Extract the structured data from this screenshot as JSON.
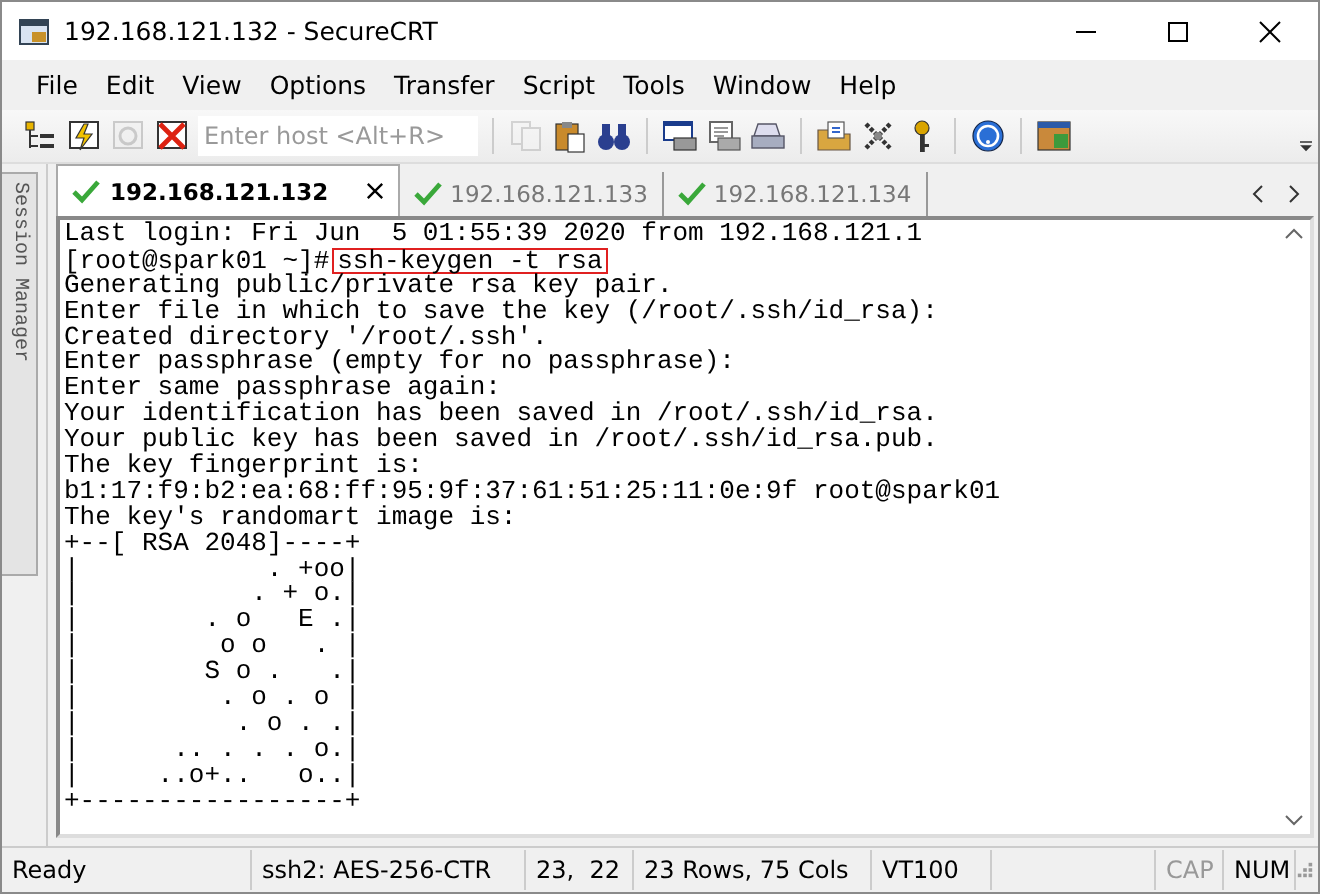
{
  "window": {
    "title": "192.168.121.132 - SecureCRT"
  },
  "menu": [
    "File",
    "Edit",
    "View",
    "Options",
    "Transfer",
    "Script",
    "Tools",
    "Window",
    "Help"
  ],
  "toolbar": {
    "buttons": [
      {
        "kind": "tree",
        "disabled": false
      },
      {
        "kind": "connect",
        "disabled": false
      },
      {
        "kind": "reconnect",
        "disabled": true
      },
      {
        "kind": "disconnect",
        "disabled": false
      },
      {
        "kind": "host",
        "placeholder": "Enter host <Alt+R>"
      },
      {
        "kind": "separator"
      },
      {
        "kind": "copy",
        "disabled": true
      },
      {
        "kind": "paste",
        "disabled": false
      },
      {
        "kind": "find",
        "disabled": false
      },
      {
        "kind": "separator"
      },
      {
        "kind": "print-screen",
        "disabled": false
      },
      {
        "kind": "print-selection",
        "disabled": false
      },
      {
        "kind": "print",
        "disabled": false
      },
      {
        "kind": "separator"
      },
      {
        "kind": "options",
        "disabled": false
      },
      {
        "kind": "tools",
        "disabled": false
      },
      {
        "kind": "key",
        "disabled": false
      },
      {
        "kind": "separator"
      },
      {
        "kind": "help",
        "disabled": false
      },
      {
        "kind": "separator"
      },
      {
        "kind": "sftp",
        "disabled": false
      }
    ]
  },
  "session_manager": {
    "label": "Session Manager"
  },
  "tabs": [
    {
      "label": "192.168.121.132",
      "selected": true
    },
    {
      "label": "192.168.121.133",
      "selected": false
    },
    {
      "label": "192.168.121.134",
      "selected": false
    }
  ],
  "terminal": {
    "lines": [
      {
        "text": "Last login: Fri Jun  5 01:55:39 2020 from 192.168.121.1"
      },
      {
        "prompt": "[root@spark01 ~]#",
        "command": "ssh-keygen -t rsa",
        "highlighted": true
      },
      {
        "text": "Generating public/private rsa key pair."
      },
      {
        "text": "Enter file in which to save the key (/root/.ssh/id_rsa):"
      },
      {
        "text": "Created directory '/root/.ssh'."
      },
      {
        "text": "Enter passphrase (empty for no passphrase):"
      },
      {
        "text": "Enter same passphrase again:"
      },
      {
        "text": "Your identification has been saved in /root/.ssh/id_rsa."
      },
      {
        "text": "Your public key has been saved in /root/.ssh/id_rsa.pub."
      },
      {
        "text": "The key fingerprint is:"
      },
      {
        "text": "b1:17:f9:b2:ea:68:ff:95:9f:37:61:51:25:11:0e:9f root@spark01"
      },
      {
        "text": "The key's randomart image is:"
      },
      {
        "text": "+--[ RSA 2048]----+"
      },
      {
        "text": "|            . +oo|"
      },
      {
        "text": "|           . + o.|"
      },
      {
        "text": "|        . o   E .|"
      },
      {
        "text": "|         o o   . |"
      },
      {
        "text": "|        S o .   .|"
      },
      {
        "text": "|         . o . o |"
      },
      {
        "text": "|          . o . .|"
      },
      {
        "text": "|      .. . . . o.|"
      },
      {
        "text": "|     ..o+..   o..|"
      },
      {
        "text": "+-----------------+"
      }
    ]
  },
  "status_bar": [
    {
      "text": "Ready",
      "disabled": false
    },
    {
      "text": "ssh2: AES-256-CTR",
      "disabled": false
    },
    {
      "text": "23,  22",
      "disabled": false
    },
    {
      "text": "23 Rows, 75 Cols",
      "disabled": false
    },
    {
      "text": "VT100",
      "disabled": false
    },
    {
      "text": "CAP",
      "disabled": true
    },
    {
      "text": "NUM",
      "disabled": false
    }
  ]
}
